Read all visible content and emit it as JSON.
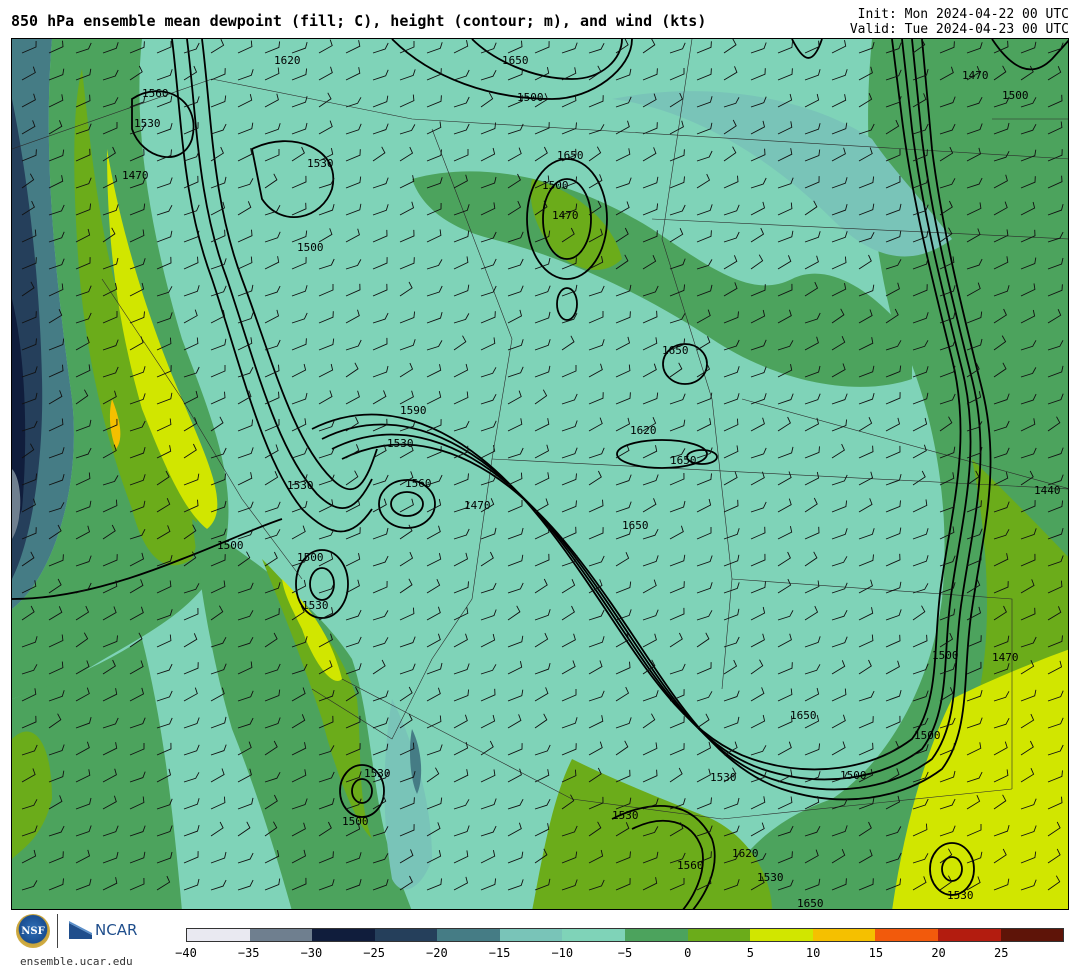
{
  "header": {
    "title": "850 hPa ensemble mean dewpoint (fill; C), height (contour; m), and wind (kts)",
    "init": "Init: Mon 2024-04-22 00 UTC",
    "valid": "Valid: Tue 2024-04-23 00 UTC"
  },
  "colorbar": {
    "colors": [
      "#e9e9f1",
      "#6f7f8f",
      "#101d3c",
      "#253f5b",
      "#457c85",
      "#79c4b8",
      "#7fd3b8",
      "#4ca35d",
      "#6bac1a",
      "#d1e600",
      "#f5c000",
      "#f25a0c",
      "#b31c0f",
      "#5e1408"
    ],
    "tick_labels": [
      "−40",
      "−35",
      "−30",
      "−25",
      "−20",
      "−15",
      "−10",
      "−5",
      "0",
      "5",
      "10",
      "15",
      "20",
      "25"
    ]
  },
  "contour_labels": [
    "1500",
    "1530",
    "1560",
    "1590",
    "1620",
    "1650",
    "1470",
    "1440"
  ],
  "footer": {
    "nsf_logo_text": "NSF",
    "ncar_logo_text": "NCAR",
    "site": "ensemble.ucar.edu"
  }
}
